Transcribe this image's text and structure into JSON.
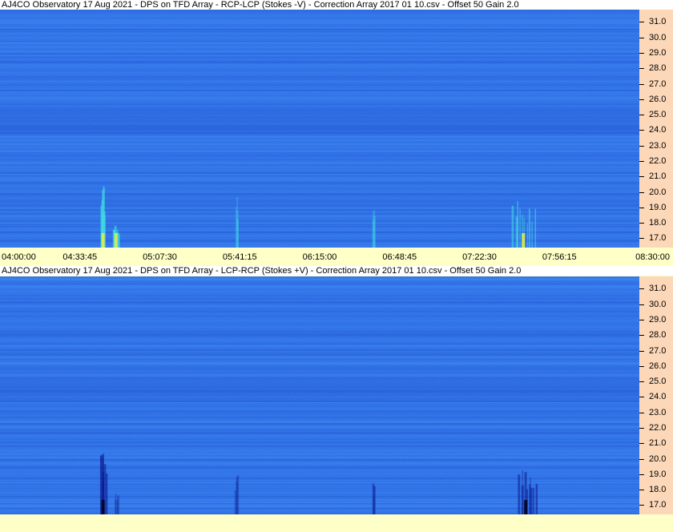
{
  "panels": [
    {
      "title": "AJ4CO Observatory 17 Aug 2021  -  DPS on TFD Array  -  RCP-LCP (Stokes -V)  -  Correction Array 2017 01 10.csv  -  Offset 50  Gain 2.0",
      "colors": {
        "background": "#2a6ee6",
        "band_dark": "#1e55d2",
        "burst": "#40e0e0",
        "burst_core": "#e8ef40"
      },
      "events": [
        {
          "time": "04:43:30",
          "kind": "bright",
          "f_low": 16.4,
          "f_high": 20.5
        },
        {
          "time": "04:49:00",
          "kind": "bright",
          "f_low": 16.4,
          "f_high": 18.0
        },
        {
          "time": "05:39:30",
          "kind": "faint",
          "f_low": 16.4,
          "f_high": 19.8
        },
        {
          "time": "06:37:30",
          "kind": "faint",
          "f_low": 16.4,
          "f_high": 19.0
        },
        {
          "time": "07:41:00",
          "kind": "bright",
          "f_low": 16.4,
          "f_high": 19.5
        }
      ]
    },
    {
      "title": "AJ4CO Observatory 17 Aug 2021  -  DPS on TFD Array  -  LCP-RCP (Stokes +V)  -  Correction Array 2017 01 10.csv  -  Offset 50  Gain 2.0",
      "colors": {
        "background": "#2a6ee6",
        "band_dark": "#1e55d2",
        "burst": "#0a1a8a",
        "burst_core": "#000020"
      },
      "events": [
        {
          "time": "04:43:30",
          "kind": "bright",
          "f_low": 16.4,
          "f_high": 20.5
        },
        {
          "time": "04:49:00",
          "kind": "faint",
          "f_low": 16.4,
          "f_high": 18.0
        },
        {
          "time": "05:39:30",
          "kind": "faint",
          "f_low": 16.4,
          "f_high": 19.0
        },
        {
          "time": "06:37:30",
          "kind": "faint",
          "f_low": 16.4,
          "f_high": 18.5
        },
        {
          "time": "07:42:00",
          "kind": "bright",
          "f_low": 16.4,
          "f_high": 19.5
        }
      ]
    }
  ],
  "chart_data": {
    "type": "heatmap",
    "x_ticks": [
      "04:00:00",
      "04:33:45",
      "05:07:30",
      "05:41:15",
      "06:15:00",
      "06:48:45",
      "07:22:30",
      "07:56:15",
      "08:30:00"
    ],
    "y_ticks": [
      "31.0",
      "30.0",
      "29.0",
      "28.0",
      "27.0",
      "26.0",
      "25.0",
      "24.0",
      "23.0",
      "22.0",
      "21.0",
      "20.0",
      "19.0",
      "18.0",
      "17.0"
    ],
    "xlim": [
      "04:00:00",
      "08:30:00"
    ],
    "ylim": [
      16.4,
      31.8
    ]
  }
}
